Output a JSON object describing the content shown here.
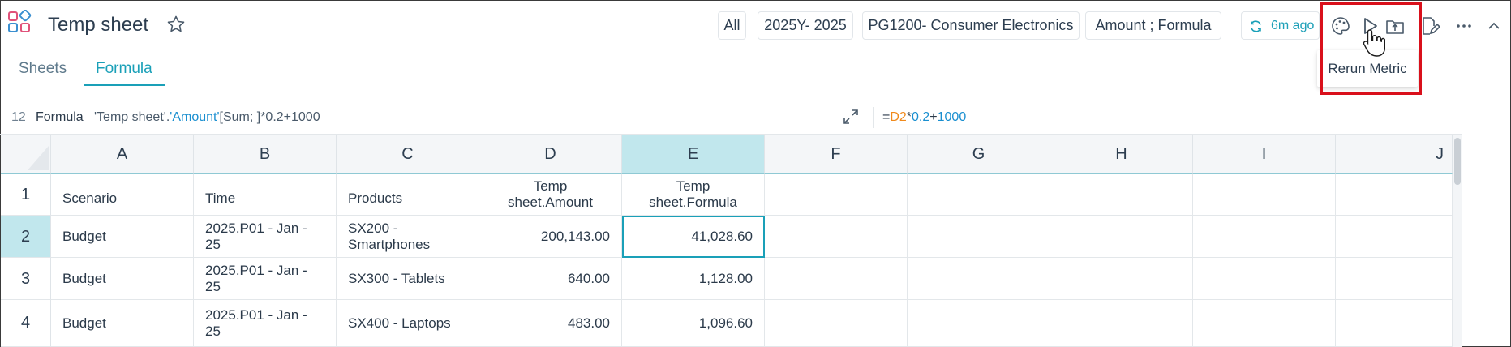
{
  "header": {
    "title": "Temp sheet",
    "filters": [
      "All",
      "2025Y- 2025",
      "PG1200- Consumer Electronics",
      "Amount ;  Formula"
    ],
    "refresh_label": "6m ago"
  },
  "tabs": [
    {
      "label": "Sheets",
      "active": false
    },
    {
      "label": "Formula",
      "active": true
    }
  ],
  "tooltip": {
    "text": "Rerun Metric"
  },
  "formula_bar": {
    "row_number": "12",
    "label": "Formula",
    "text_prefix": "'Temp sheet'.",
    "text_ref": "'Amount'",
    "text_suffix": "[Sum; ]*0.2+1000",
    "expr_eq": "=",
    "expr_cell": "D2",
    "expr_op1": "*",
    "expr_num1": "0.2",
    "expr_op2": "+",
    "expr_num2": "1000"
  },
  "grid": {
    "columns": [
      "A",
      "B",
      "C",
      "D",
      "E",
      "F",
      "G",
      "H",
      "I",
      "J"
    ],
    "selected_column": "E",
    "rows": [
      {
        "num": "1",
        "cells": [
          "Scenario",
          "Time",
          "Products",
          "Temp sheet.Amount",
          "Temp sheet.Formula"
        ]
      },
      {
        "num": "2",
        "cells": [
          "Budget",
          "2025.P01 - Jan - 25",
          "SX200 - Smartphones",
          "200,143.00",
          "41,028.60"
        ]
      },
      {
        "num": "3",
        "cells": [
          "Budget",
          "2025.P01 - Jan - 25",
          "SX300 - Tablets",
          "640.00",
          "1,128.00"
        ]
      },
      {
        "num": "4",
        "cells": [
          "Budget",
          "2025.P01 - Jan - 25",
          "SX400 - Laptops",
          "483.00",
          "1,096.60"
        ]
      }
    ]
  },
  "colors": {
    "accent": "#1aa0b8",
    "highlight": "#d9101b",
    "selected_fill": "#c1e7ed"
  }
}
